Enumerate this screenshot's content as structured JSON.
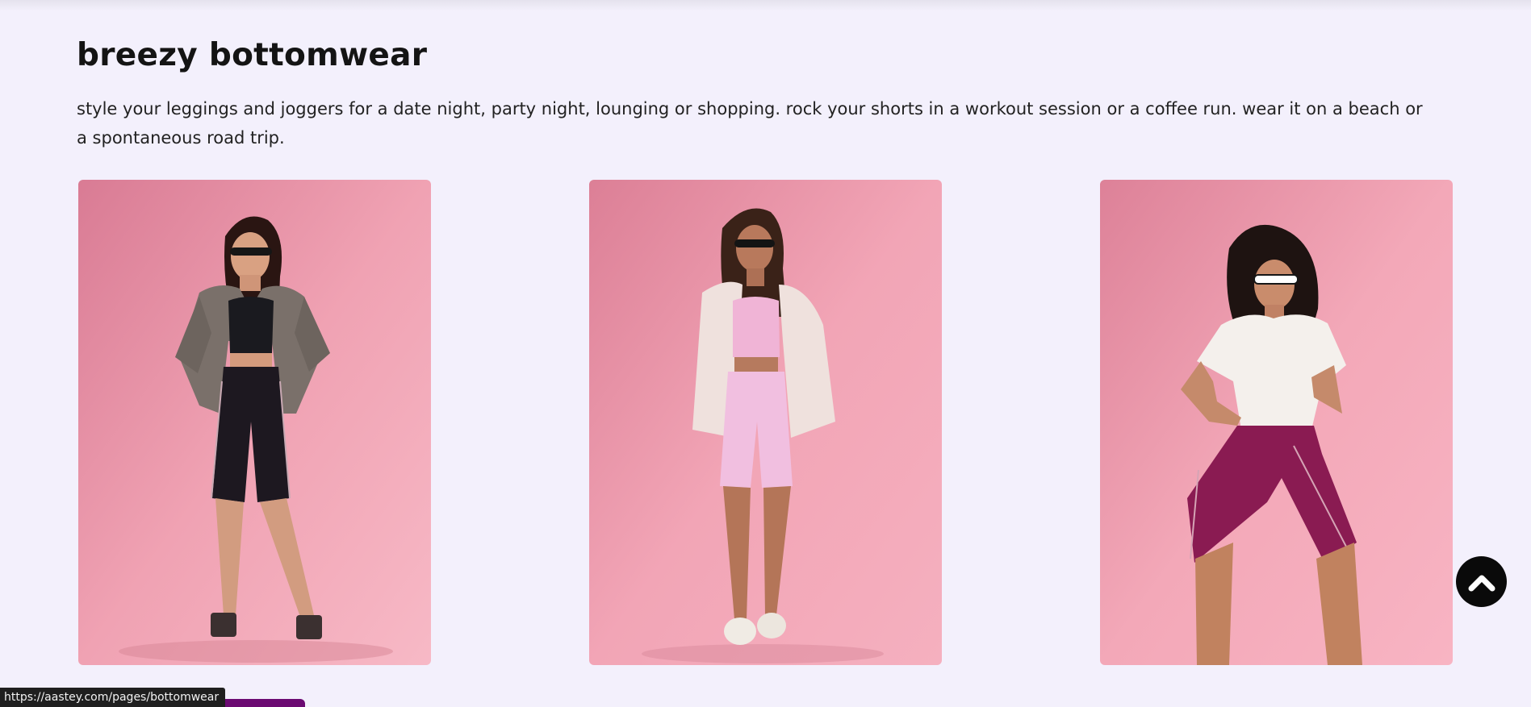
{
  "section": {
    "title": "breezy bottomwear",
    "description": "style your leggings and joggers for a date night, party night, lounging or shopping. rock your shorts in a workout session or a coffee run. wear it on a beach or a spontaneous road trip."
  },
  "products": [
    {
      "image_icon": "model-black-bike-shorts-photo",
      "outfit": "black bike shorts",
      "background": "#f0a2b3"
    },
    {
      "image_icon": "model-pink-bike-shorts-photo",
      "outfit": "pink bike shorts",
      "background": "#f2a5b6"
    },
    {
      "image_icon": "model-maroon-bike-shorts-photo",
      "outfit": "maroon bike shorts",
      "background": "#f3a8b8"
    }
  ],
  "scroll_to_top": {
    "icon": "chevron-up-icon"
  },
  "status_bar": {
    "url": "https://aastey.com/pages/bottomwear"
  },
  "colors": {
    "page_background": "#f3f0fc",
    "photo_background": "#ee9aae",
    "accent_purple": "#6b0a72",
    "scroll_button": "#0a0a0a"
  }
}
